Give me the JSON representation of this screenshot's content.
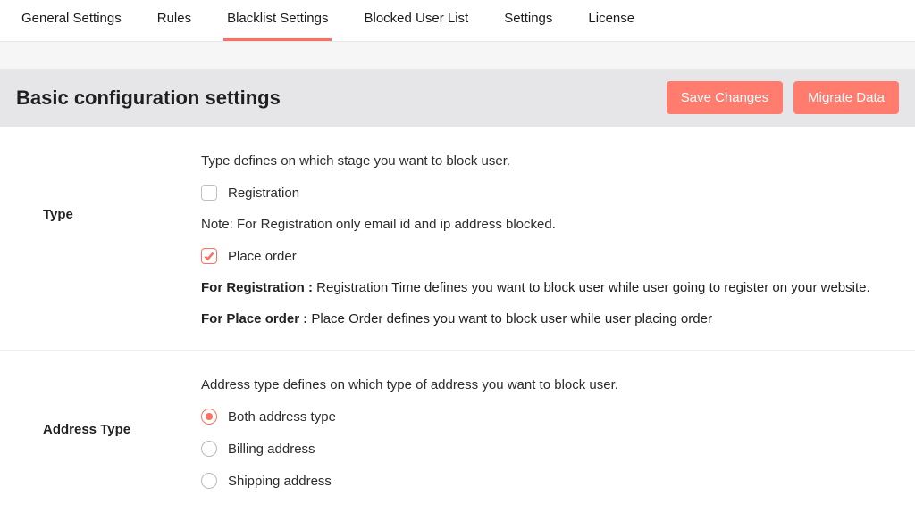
{
  "tabs": [
    {
      "label": "General Settings",
      "active": false
    },
    {
      "label": "Rules",
      "active": false
    },
    {
      "label": "Blacklist Settings",
      "active": true
    },
    {
      "label": "Blocked User List",
      "active": false
    },
    {
      "label": "Settings",
      "active": false
    },
    {
      "label": "License",
      "active": false
    }
  ],
  "header": {
    "title": "Basic configuration settings",
    "save_label": "Save Changes",
    "migrate_label": "Migrate Data"
  },
  "type_section": {
    "label": "Type",
    "description": "Type defines on which stage you want to block user.",
    "options": [
      {
        "label": "Registration",
        "checked": false
      },
      {
        "label": "Place order",
        "checked": true
      }
    ],
    "note": "Note: For Registration only email id and ip address blocked.",
    "def_reg_prefix": "For Registration : ",
    "def_reg_text": "Registration Time defines you want to block user while user going to register on your website.",
    "def_place_prefix": "For Place order : ",
    "def_place_text": "Place Order defines you want to block user while user placing order"
  },
  "address_section": {
    "label": "Address Type",
    "description": "Address type defines on which type of address you want to block user.",
    "options": [
      {
        "label": "Both address type",
        "checked": true
      },
      {
        "label": "Billing address",
        "checked": false
      },
      {
        "label": "Shipping address",
        "checked": false
      }
    ]
  }
}
